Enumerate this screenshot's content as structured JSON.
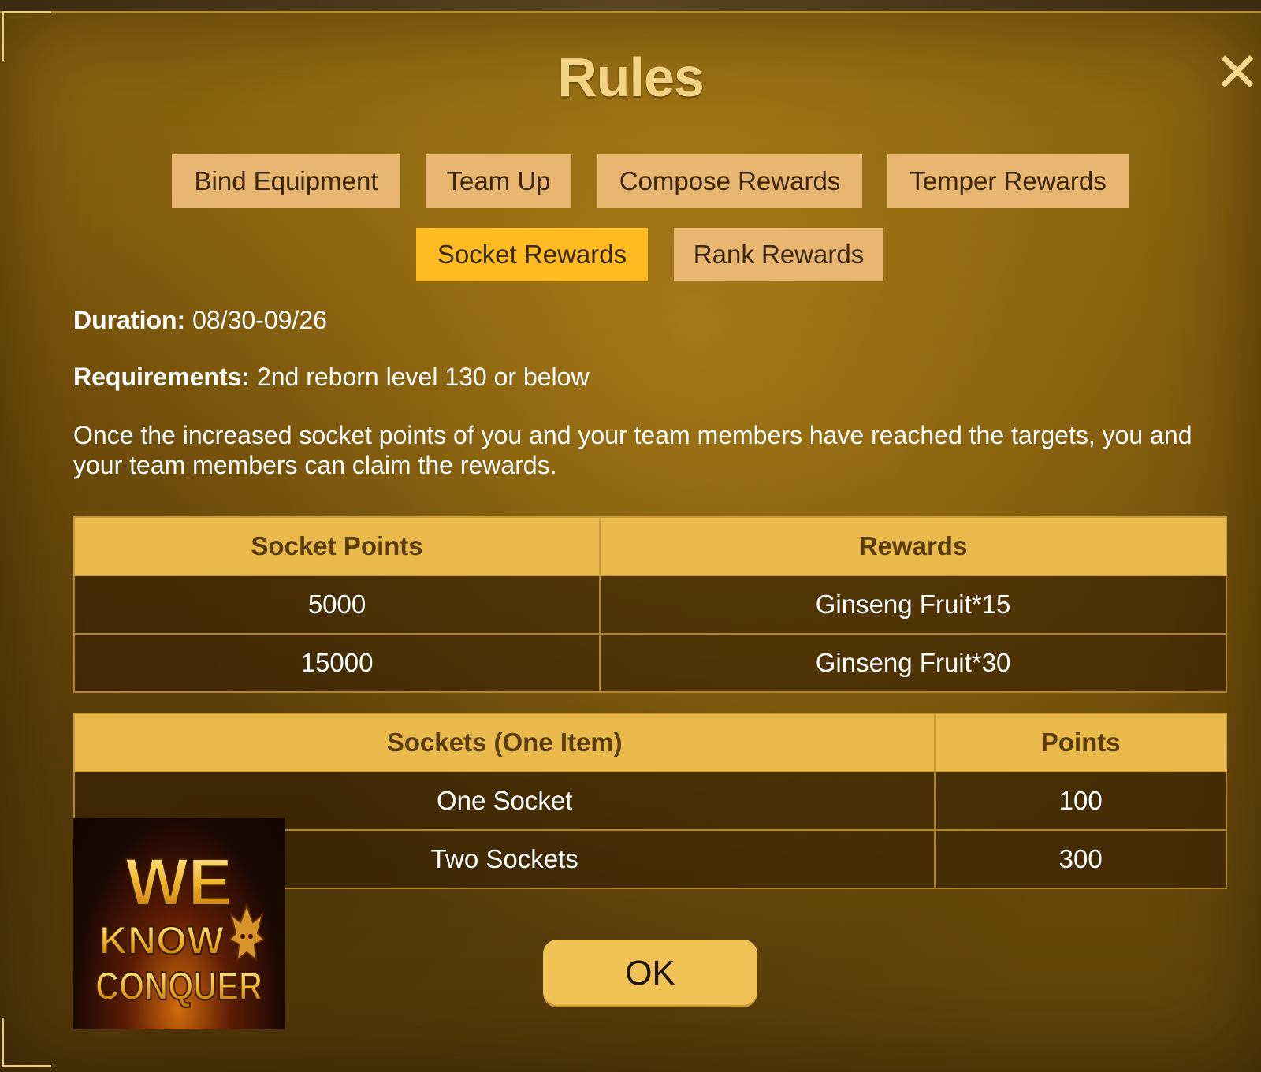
{
  "dialog": {
    "title": "Rules",
    "close_symbol": "✕"
  },
  "tabs": [
    {
      "label": "Bind Equipment",
      "active": false
    },
    {
      "label": "Team Up",
      "active": false
    },
    {
      "label": "Compose Rewards",
      "active": false
    },
    {
      "label": "Temper Rewards",
      "active": false
    },
    {
      "label": "Socket Rewards",
      "active": true
    },
    {
      "label": "Rank Rewards",
      "active": false
    }
  ],
  "info": {
    "duration_label": "Duration:",
    "duration_value": " 08/30-09/26",
    "requirements_label": "Requirements:",
    "requirements_value": " 2nd reborn level 130 or below",
    "description": "Once the increased socket points of you and your team members have reached the targets, you and your team members can claim the rewards."
  },
  "rewards_table": {
    "headers": [
      "Socket Points",
      "Rewards"
    ],
    "rows": [
      [
        "5000",
        "Ginseng Fruit*15"
      ],
      [
        "15000",
        "Ginseng Fruit*30"
      ]
    ]
  },
  "points_table": {
    "headers": [
      "Sockets (One Item)",
      "Points"
    ],
    "rows": [
      [
        "One Socket",
        "100"
      ],
      [
        "Two Sockets",
        "300"
      ]
    ]
  },
  "ok_button": {
    "label": "OK"
  },
  "logo": {
    "line1": "WE",
    "line2": "KNOW",
    "line3": "CONQUER",
    "icon": "dragon-icon"
  },
  "colors": {
    "active_tab": "#ffbb22",
    "inactive_tab": "#e8b670",
    "title": "#f3d283",
    "table_header": "#e9b94c"
  }
}
